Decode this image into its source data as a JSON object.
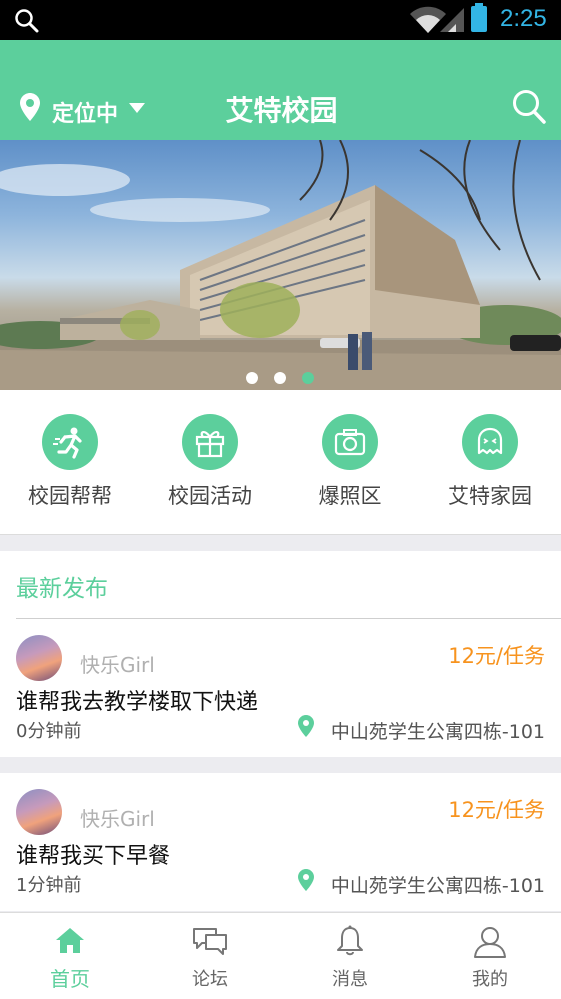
{
  "status_bar": {
    "time": "2:25"
  },
  "header": {
    "location": "定位中",
    "title": "艾特校园"
  },
  "banner": {
    "dots": 3,
    "active_dot": 3
  },
  "categories": [
    {
      "label": "校园帮帮",
      "icon": "runner-icon"
    },
    {
      "label": "校园活动",
      "icon": "gift-icon"
    },
    {
      "label": "爆照区",
      "icon": "camera-icon"
    },
    {
      "label": "艾特家园",
      "icon": "ghost-icon"
    }
  ],
  "latest": {
    "title": "最新发布"
  },
  "posts": [
    {
      "user": "快乐Girl",
      "price": "12元/任务",
      "title": "谁帮我去教学楼取下快递",
      "time": "0分钟前",
      "location": "中山苑学生公寓四栋-101"
    },
    {
      "user": "快乐Girl",
      "price": "12元/任务",
      "title": "谁帮我买下早餐",
      "time": "1分钟前",
      "location": "中山苑学生公寓四栋-101"
    }
  ],
  "tabs": [
    {
      "label": "首页",
      "icon": "home-icon",
      "active": true
    },
    {
      "label": "论坛",
      "icon": "chat-bubbles-icon",
      "active": false
    },
    {
      "label": "消息",
      "icon": "bell-icon",
      "active": false
    },
    {
      "label": "我的",
      "icon": "user-icon",
      "active": false
    }
  ],
  "colors": {
    "accent": "#5ccf9c",
    "price": "#f7931e",
    "status_time": "#33b5e5"
  }
}
